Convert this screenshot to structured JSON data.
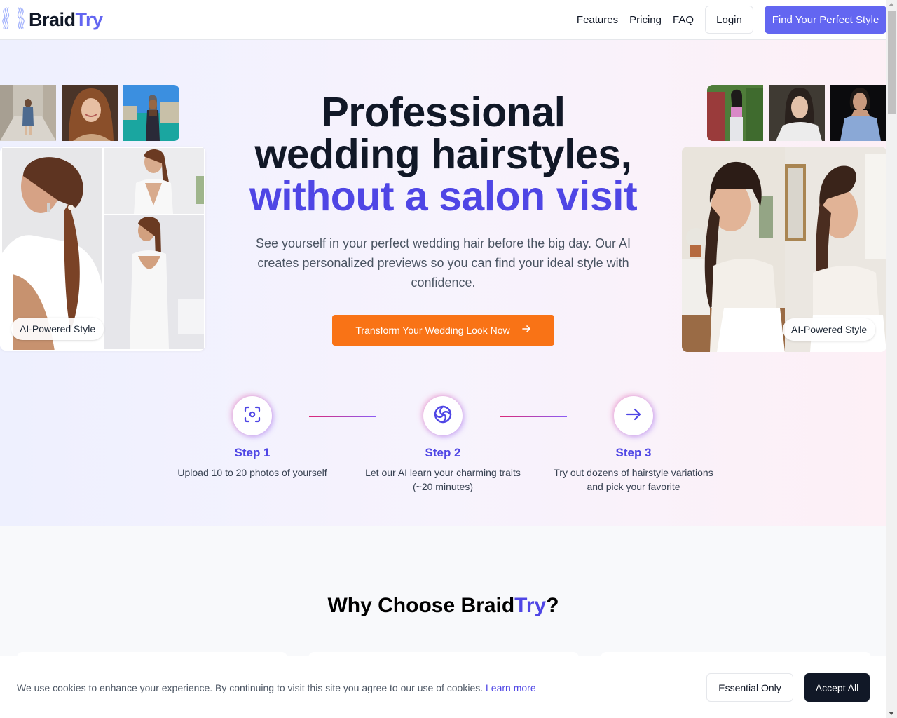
{
  "brand": {
    "name_main": "Braid",
    "name_accent": "Try",
    "accent_color": "#6366f1",
    "logo_icon": "braid-icon"
  },
  "nav": {
    "links": [
      "Features",
      "Pricing",
      "FAQ"
    ],
    "login_label": "Login",
    "cta_label": "Find Your Perfect Style"
  },
  "hero": {
    "title_line1": "Professional",
    "title_line2": "wedding hairstyles,",
    "title_accent": "without a salon visit",
    "subtitle": "See yourself in your perfect wedding hair before the big day. Our AI creates personalized previews so you can find your ideal style with confidence.",
    "cta_label": "Transform Your Wedding Look Now",
    "cta_icon": "arrow-right-icon",
    "cta_color": "#f97316",
    "left_badge": "AI-Powered Style",
    "right_badge": "AI-Powered Style",
    "left_thumbnails": [
      "woman-in-alley-photo",
      "smiling-woman-selfie-photo",
      "woman-by-sea-photo"
    ],
    "right_thumbnails": [
      "woman-in-garden-photo",
      "woman-selfie-photo",
      "woman-in-striped-shirt-photo"
    ],
    "left_collage": [
      "bride-low-ponytail-back-photo",
      "bride-ponytail-front-photo",
      "bride-ponytail-full-back-photo"
    ],
    "right_collage": [
      "bride-braid-front-photo",
      "bride-braid-side-photo"
    ]
  },
  "steps": [
    {
      "title": "Step 1",
      "desc": "Upload 10 to 20 photos of yourself",
      "icon": "scan-face-icon"
    },
    {
      "title": "Step 2",
      "desc": "Let our AI learn your charming traits (~20 minutes)",
      "icon": "ai-swirl-icon"
    },
    {
      "title": "Step 3",
      "desc": "Try out dozens of hairstyle variations and pick your favorite",
      "icon": "arrow-right-icon"
    }
  ],
  "why": {
    "title_prefix": "Why Choose Braid",
    "title_accent": "Try",
    "title_suffix": "?"
  },
  "cookie": {
    "text": "We use cookies to enhance your experience. By continuing to visit this site you agree to our use of cookies.",
    "link_label": "Learn more",
    "essential_label": "Essential Only",
    "accept_label": "Accept All"
  }
}
